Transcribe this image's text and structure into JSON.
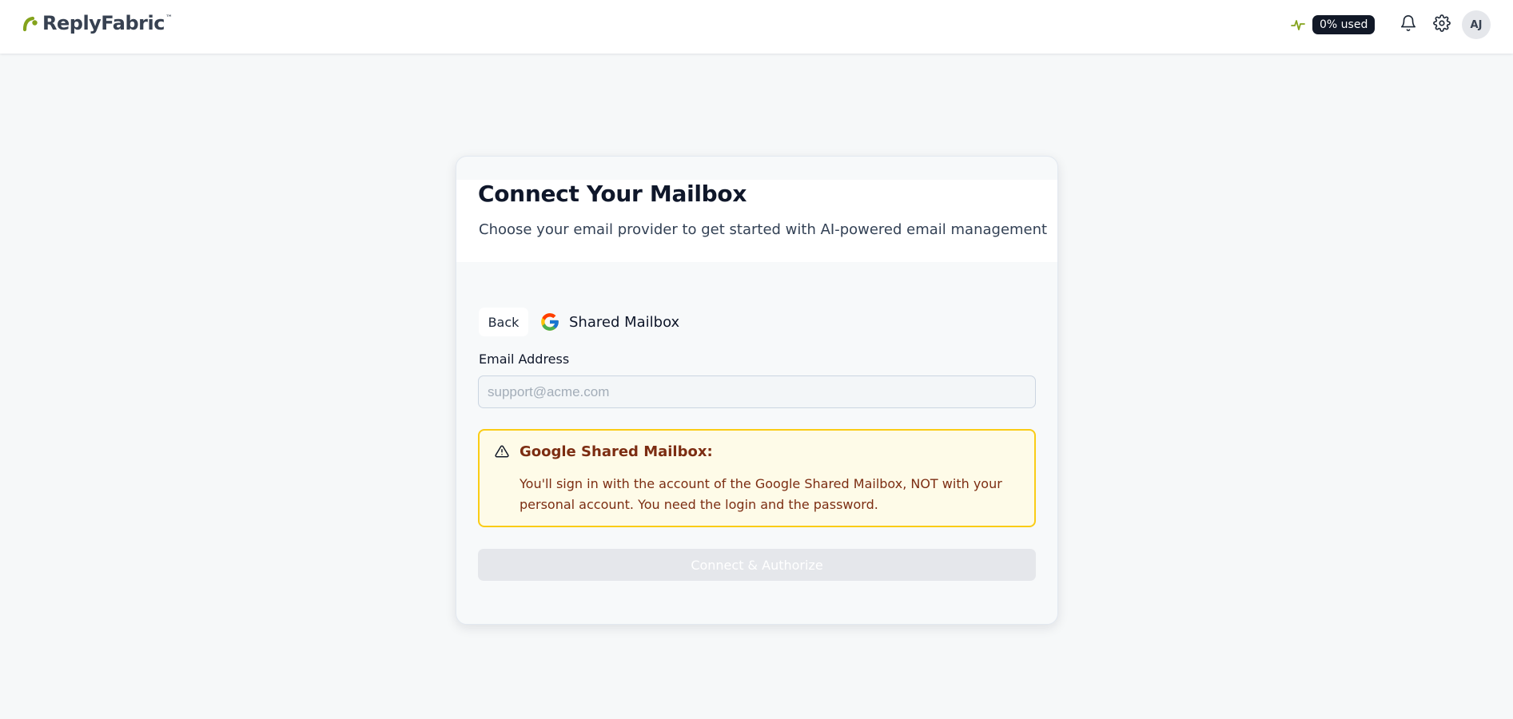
{
  "header": {
    "brand_name": "ReplyFabric",
    "brand_tm": "™",
    "usage_label": "0% used",
    "icons": [
      "activity-icon",
      "bell-icon",
      "gear-icon"
    ],
    "avatar_initials": "AJ",
    "accent_color": "#84a31c"
  },
  "card": {
    "title": "Connect Your Mailbox",
    "subtitle": "Choose your email provider to get started with AI-powered email management",
    "back_label": "Back",
    "provider_icon": "google-icon",
    "provider_name": "Shared Mailbox",
    "email_label": "Email Address",
    "email_value": "",
    "email_placeholder": "support@acme.com",
    "warning": {
      "icon": "warning-triangle-icon",
      "title": "Google Shared Mailbox:",
      "body": "You'll sign in with the account of the Google Shared Mailbox, NOT with your personal account. You need the login and the password.",
      "border_color": "#facc15",
      "background_color": "#fefbe8",
      "text_color": "#7c2d12"
    },
    "connect_label": "Connect & Authorize",
    "connect_disabled": true
  }
}
